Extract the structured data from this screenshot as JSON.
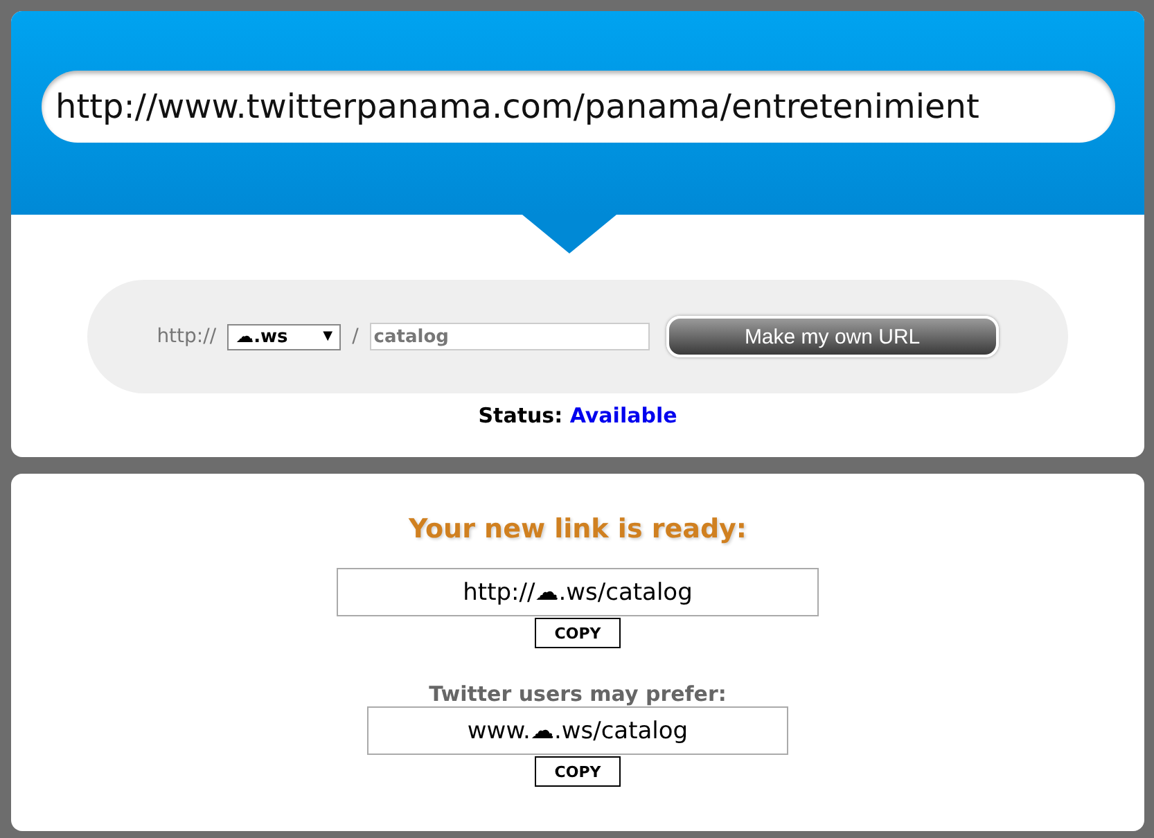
{
  "long_url": {
    "value": "http://www.twitterpanama.com/panama/entretenimient"
  },
  "custom": {
    "prefix": "http://",
    "domain": "☁.ws",
    "caret": "▼",
    "separator": "/",
    "slug": "catalog",
    "button": "Make my own URL"
  },
  "status": {
    "label": "Status:",
    "value": "Available"
  },
  "result": {
    "heading": "Your new link is ready:",
    "links": [
      {
        "url": "http://☁.ws/catalog",
        "copy": "COPY"
      },
      {
        "caption": "Twitter users may prefer:",
        "url": "www.☁.ws/catalog",
        "copy": "COPY"
      }
    ]
  }
}
